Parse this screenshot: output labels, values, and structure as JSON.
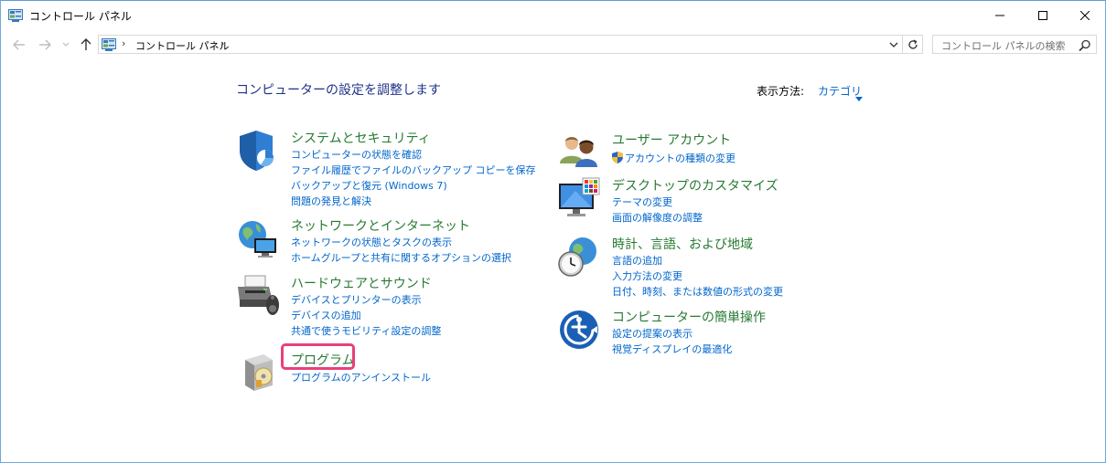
{
  "window": {
    "title": "コントロール パネル"
  },
  "address": {
    "path": "コントロール パネル",
    "separator": "›"
  },
  "search": {
    "placeholder": "コントロール パネルの検索"
  },
  "header": {
    "title": "コンピューターの設定を調整します",
    "view_label": "表示方法:",
    "view_value": "カテゴリ"
  },
  "categories": {
    "system": {
      "title": "システムとセキュリティ",
      "links": [
        "コンピューターの状態を確認",
        "ファイル履歴でファイルのバックアップ コピーを保存",
        "バックアップと復元 (Windows 7)",
        "問題の発見と解決"
      ]
    },
    "network": {
      "title": "ネットワークとインターネット",
      "links": [
        "ネットワークの状態とタスクの表示",
        "ホームグループと共有に関するオプションの選択"
      ]
    },
    "hardware": {
      "title": "ハードウェアとサウンド",
      "links": [
        "デバイスとプリンターの表示",
        "デバイスの追加",
        "共通で使うモビリティ設定の調整"
      ]
    },
    "programs": {
      "title": "プログラム",
      "links": [
        "プログラムのアンインストール"
      ]
    },
    "users": {
      "title": "ユーザー アカウント",
      "links": [
        "アカウントの種類の変更"
      ]
    },
    "desktop": {
      "title": "デスクトップのカスタマイズ",
      "links": [
        "テーマの変更",
        "画面の解像度の調整"
      ]
    },
    "clock": {
      "title": "時計、言語、および地域",
      "links": [
        "言語の追加",
        "入力方法の変更",
        "日付、時刻、または数値の形式の変更"
      ]
    },
    "ease": {
      "title": "コンピューターの簡単操作",
      "links": [
        "設定の提案の表示",
        "視覚ディスプレイの最適化"
      ]
    }
  }
}
